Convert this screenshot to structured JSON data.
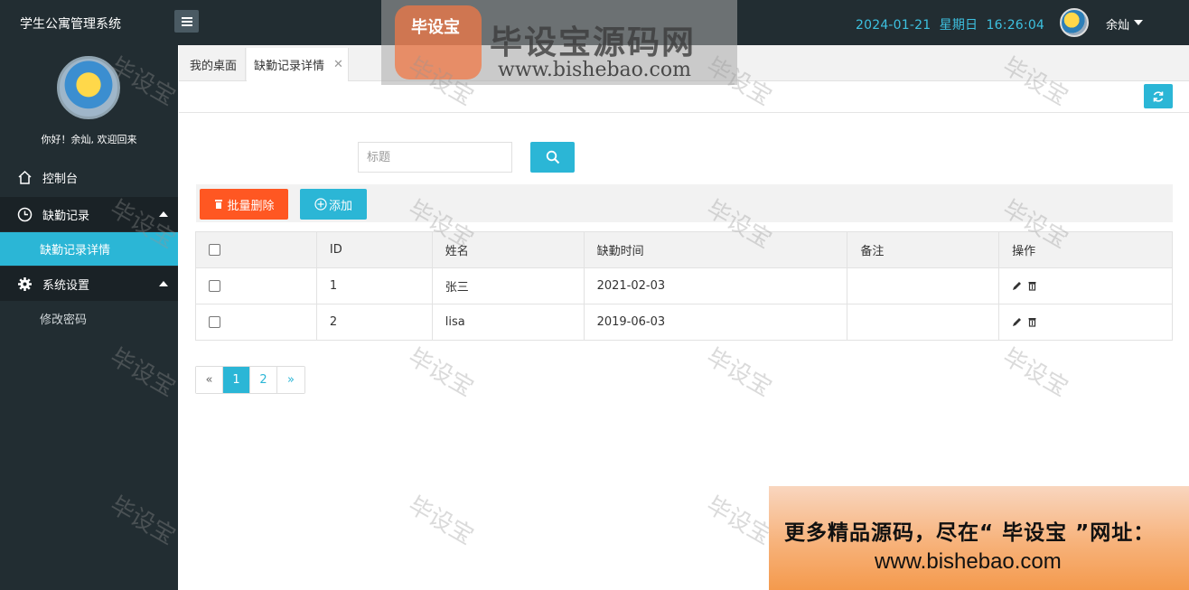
{
  "header": {
    "brand": "学生公寓管理系统",
    "datetime": "2024-01-21  星期日  16:26:04",
    "user_name": "余灿"
  },
  "sidebar": {
    "welcome": "你好！余灿, 欢迎回来",
    "items": [
      {
        "label": "控制台",
        "icon": "home-icon"
      },
      {
        "label": "缺勤记录",
        "icon": "clock-icon"
      },
      {
        "label": "缺勤记录详情"
      },
      {
        "label": "系统设置",
        "icon": "gear-icon"
      },
      {
        "label": "修改密码"
      }
    ]
  },
  "tabs": [
    {
      "label": "我的桌面"
    },
    {
      "label": "缺勤记录详情"
    }
  ],
  "search": {
    "placeholder": "标题"
  },
  "actions": {
    "batch_delete": "批量删除",
    "add": "添加"
  },
  "table": {
    "headers": [
      "ID",
      "姓名",
      "缺勤时间",
      "备注",
      "操作"
    ],
    "rows": [
      {
        "id": "1",
        "name": "张三",
        "time": "2021-02-03",
        "note": ""
      },
      {
        "id": "2",
        "name": "lisa",
        "time": "2019-06-03",
        "note": ""
      }
    ]
  },
  "pagination": {
    "prev": "«",
    "pages": [
      "1",
      "2"
    ],
    "next": "»",
    "current": "1"
  },
  "watermark": {
    "text": "毕设宝",
    "logo_title": "毕设宝源码网",
    "logo_url": "www.bishebao.com"
  },
  "banner": {
    "line1": "更多精品源码，尽在“ 毕设宝 ”网址：",
    "line2": "www.bishebao.com"
  },
  "colors": {
    "accent": "#2bb6d6",
    "danger": "#ff5722",
    "sidebar": "#222d32"
  }
}
